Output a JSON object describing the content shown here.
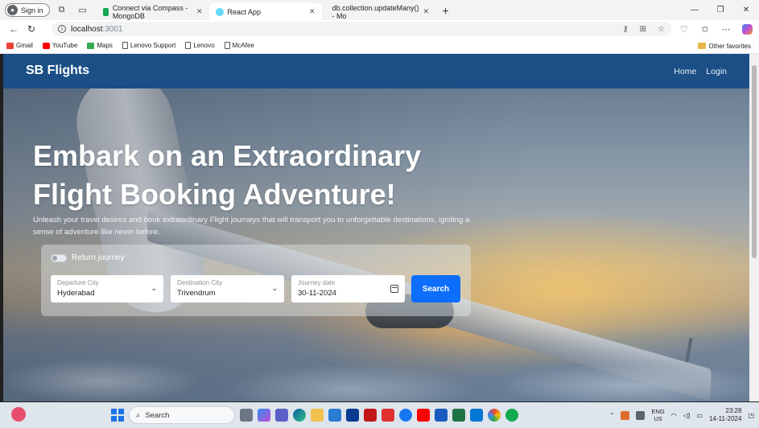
{
  "browser": {
    "signin_label": "Sign in",
    "tabs": [
      {
        "title": "Connect via Compass - MongoDB",
        "active": false
      },
      {
        "title": "React App",
        "active": true
      },
      {
        "title": "db.collection.updateMany() - Mo",
        "active": false
      }
    ],
    "url_host": "localhost",
    "url_port": ":3001",
    "favorites": [
      "Gmail",
      "YouTube",
      "Maps",
      "Lenovo Support",
      "Lenovo",
      "McAfee"
    ],
    "other_favorites": "Other favorites"
  },
  "site": {
    "brand": "SB Flights",
    "nav": {
      "home": "Home",
      "login": "Login"
    }
  },
  "hero": {
    "headline_line1": "Embark on an Extraordinary",
    "headline_line2": "Flight Booking Adventure!",
    "tagline": "Unleash your travel desires and book extraordinary Flight journeys that will transport you to unforgettable destinations, igniting a sense of adventure like never before."
  },
  "search_form": {
    "return_toggle_label": "Return journey",
    "return_toggle_on": false,
    "departure": {
      "label": "Departure City",
      "value": "Hyderabad"
    },
    "destination": {
      "label": "Destination City",
      "value": "Trivendrum"
    },
    "date": {
      "label": "Journey date",
      "value": "30-11-2024"
    },
    "search_button": "Search"
  },
  "taskbar": {
    "search_label": "Search",
    "lang_line1": "ENG",
    "lang_line2": "US",
    "time": "23:28",
    "date": "14-11-2024"
  }
}
